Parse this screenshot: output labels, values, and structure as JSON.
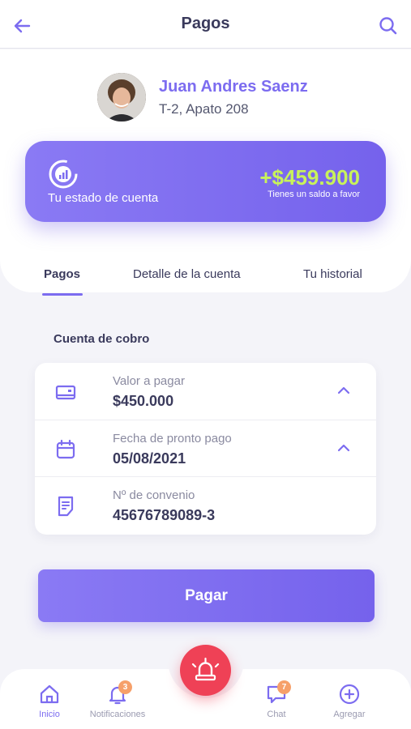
{
  "header": {
    "title": "Pagos"
  },
  "profile": {
    "name": "Juan Andres Saenz",
    "unit": "T-2, Apato 208"
  },
  "balance": {
    "label": "Tu estado de cuenta",
    "amount": "+$459.900",
    "note": "Tienes un saldo a favor"
  },
  "tabs": [
    {
      "label": "Pagos",
      "active": true
    },
    {
      "label": "Detalle de la cuenta",
      "active": false
    },
    {
      "label": "Tu historial",
      "active": false
    }
  ],
  "section": {
    "title": "Cuenta de cobro"
  },
  "rows": [
    {
      "label": "Valor a pagar",
      "value": "$450.000",
      "icon": "card-icon"
    },
    {
      "label": "Fecha de pronto pago",
      "value": "05/08/2021",
      "icon": "calendar-icon"
    },
    {
      "label": "Nº de convenio",
      "value": "45676789089-3",
      "icon": "document-icon"
    }
  ],
  "pay_button": {
    "label": "Pagar"
  },
  "nav": {
    "home": {
      "label": "Inicio"
    },
    "notifications": {
      "label": "Notificaciones",
      "badge": "3"
    },
    "chat": {
      "label": "Chat",
      "badge": "7"
    },
    "add": {
      "label": "Agregar"
    }
  },
  "colors": {
    "accent": "#7c6cf0",
    "balance_amount": "#c8f25a",
    "panic": "#ef4156",
    "badge": "#f6a06a"
  }
}
